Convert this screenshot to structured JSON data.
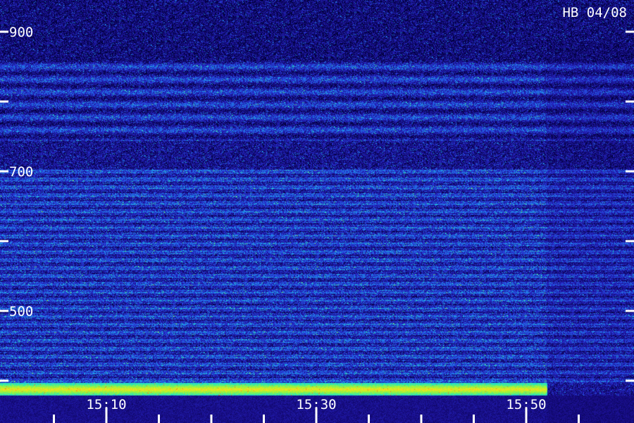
{
  "chart_data": {
    "type": "heatmap",
    "title": "HB 04/08",
    "y_ticks": [
      {
        "value": 900,
        "label": "900"
      },
      {
        "value": 800,
        "label": ""
      },
      {
        "value": 700,
        "label": "700"
      },
      {
        "value": 600,
        "label": ""
      },
      {
        "value": 500,
        "label": "500"
      },
      {
        "value": 400,
        "label": ""
      }
    ],
    "ylim": [
      383,
      917
    ],
    "x_ticks": [
      {
        "value": 5,
        "label": ""
      },
      {
        "value": 10,
        "label": "15:10"
      },
      {
        "value": 15,
        "label": ""
      },
      {
        "value": 20,
        "label": ""
      },
      {
        "value": 25,
        "label": ""
      },
      {
        "value": 30,
        "label": "15:30"
      },
      {
        "value": 35,
        "label": ""
      },
      {
        "value": 40,
        "label": ""
      },
      {
        "value": 45,
        "label": ""
      },
      {
        "value": 50,
        "label": "15:50"
      },
      {
        "value": 55,
        "label": ""
      }
    ],
    "xlim": [
      0,
      60
    ],
    "colormap": [
      "#00003a",
      "#1a0e8c",
      "#2833d6",
      "#1f8ef0",
      "#22e6c0",
      "#9cf53a",
      "#ffe11a",
      "#ff3b10"
    ],
    "strong_band": {
      "y": 389,
      "x_start": 0,
      "x_end": 52,
      "level": "high"
    },
    "grid": false
  }
}
